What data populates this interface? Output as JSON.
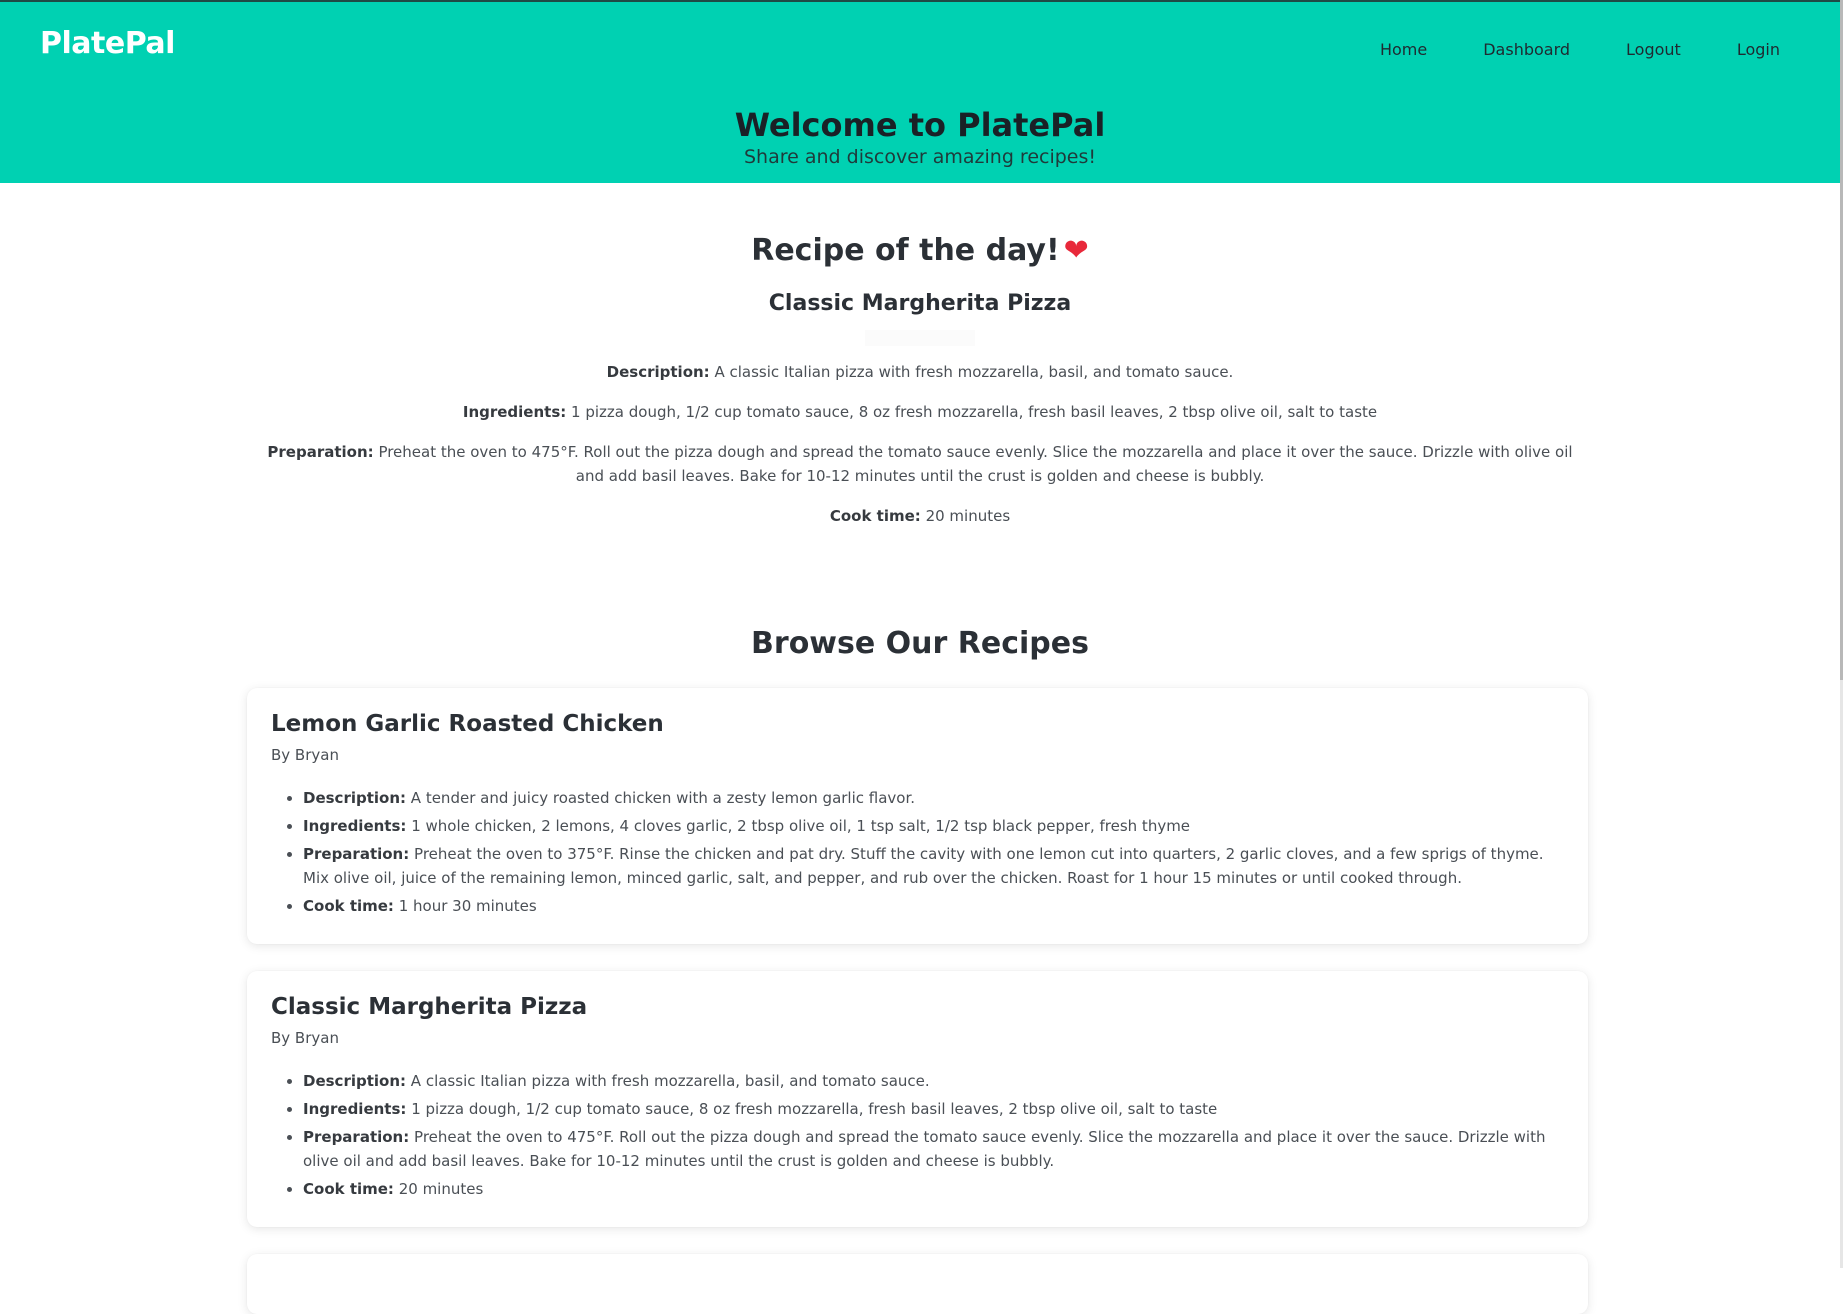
{
  "app": {
    "brand": "PlatePal"
  },
  "nav": {
    "items": [
      {
        "label": "Home"
      },
      {
        "label": "Dashboard"
      },
      {
        "label": "Logout"
      },
      {
        "label": "Login"
      }
    ]
  },
  "hero": {
    "title": "Welcome to PlatePal",
    "subtitle": "Share and discover amazing recipes!"
  },
  "recipe_of_the_day": {
    "heading": "Recipe of the day!",
    "heart_icon": "❤",
    "name": "Classic Margherita Pizza",
    "description_label": "Description:",
    "description": "A classic Italian pizza with fresh mozzarella, basil, and tomato sauce.",
    "ingredients_label": "Ingredients:",
    "ingredients": "1 pizza dough, 1/2 cup tomato sauce, 8 oz fresh mozzarella, fresh basil leaves, 2 tbsp olive oil, salt to taste",
    "preparation_label": "Preparation:",
    "preparation": "Preheat the oven to 475°F. Roll out the pizza dough and spread the tomato sauce evenly. Slice the mozzarella and place it over the sauce. Drizzle with olive oil and add basil leaves. Bake for 10-12 minutes until the crust is golden and cheese is bubbly.",
    "cook_time_label": "Cook time:",
    "cook_time": "20 minutes"
  },
  "browse": {
    "title": "Browse Our Recipes",
    "recipes": [
      {
        "name": "Lemon Garlic Roasted Chicken",
        "author": "By Bryan",
        "description_label": "Description:",
        "description": "A tender and juicy roasted chicken with a zesty lemon garlic flavor.",
        "ingredients_label": "Ingredients:",
        "ingredients": "1 whole chicken, 2 lemons, 4 cloves garlic, 2 tbsp olive oil, 1 tsp salt, 1/2 tsp black pepper, fresh thyme",
        "preparation_label": "Preparation:",
        "preparation": "Preheat the oven to 375°F. Rinse the chicken and pat dry. Stuff the cavity with one lemon cut into quarters, 2 garlic cloves, and a few sprigs of thyme. Mix olive oil, juice of the remaining lemon, minced garlic, salt, and pepper, and rub over the chicken. Roast for 1 hour 15 minutes or until cooked through.",
        "cook_time_label": "Cook time:",
        "cook_time": "1 hour 30 minutes"
      },
      {
        "name": "Classic Margherita Pizza",
        "author": "By Bryan",
        "description_label": "Description:",
        "description": "A classic Italian pizza with fresh mozzarella, basil, and tomato sauce.",
        "ingredients_label": "Ingredients:",
        "ingredients": "1 pizza dough, 1/2 cup tomato sauce, 8 oz fresh mozzarella, fresh basil leaves, 2 tbsp olive oil, salt to taste",
        "preparation_label": "Preparation:",
        "preparation": "Preheat the oven to 475°F. Roll out the pizza dough and spread the tomato sauce evenly. Slice the mozzarella and place it over the sauce. Drizzle with olive oil and add basil leaves. Bake for 10-12 minutes until the crust is golden and cheese is bubbly.",
        "cook_time_label": "Cook time:",
        "cook_time": "20 minutes"
      }
    ]
  },
  "colors": {
    "hero_background": "#00d1b2",
    "brand_text": "#ffffff",
    "heart": "#e8283a"
  }
}
